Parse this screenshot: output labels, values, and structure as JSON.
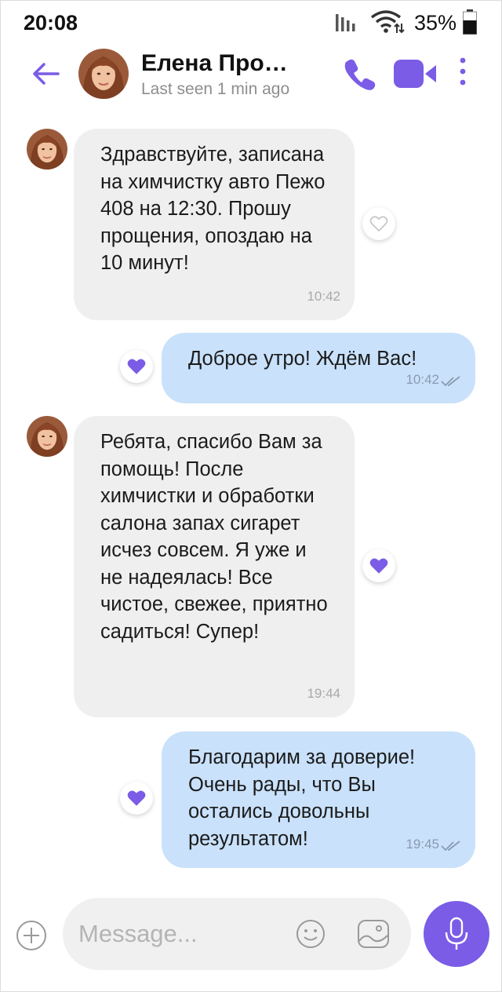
{
  "status_bar": {
    "time": "20:08",
    "battery": "35%"
  },
  "header": {
    "contact_name": "Елена Про…",
    "last_seen": "Last seen 1 min ago"
  },
  "messages": [
    {
      "direction": "incoming",
      "text": "Здравствуйте, записана на химчистку авто Пежо 408 на 12:30. Прошу прощения, опоздаю на 10 минут!",
      "time": "10:42",
      "liked": false
    },
    {
      "direction": "outgoing",
      "text": "Доброе утро! Ждём Вас!",
      "time": "10:42",
      "liked": true,
      "status": "read"
    },
    {
      "direction": "incoming",
      "text": "Ребята, спасибо Вам за помощь! После химчистки и обработки салона запах сигарет исчез совсем. Я уже и не надеялась! Все чистое, свежее, приятно садиться! Супер!",
      "time": "19:44",
      "liked": true
    },
    {
      "direction": "outgoing",
      "text": "Благодарим за доверие! Очень рады, что Вы остались довольны результатом!",
      "time": "19:45",
      "liked": true,
      "status": "read"
    }
  ],
  "composer": {
    "placeholder": "Message..."
  },
  "colors": {
    "accent": "#7a5ce6",
    "incoming_bubble": "#efefef",
    "outgoing_bubble": "#c9e1fb",
    "heart": "#7a5ce6"
  },
  "icons": [
    "back-arrow-icon",
    "phone-icon",
    "video-camera-icon",
    "more-vertical-icon",
    "heart-icon",
    "double-check-icon",
    "plus-circle-icon",
    "smile-icon",
    "image-icon",
    "microphone-icon"
  ]
}
